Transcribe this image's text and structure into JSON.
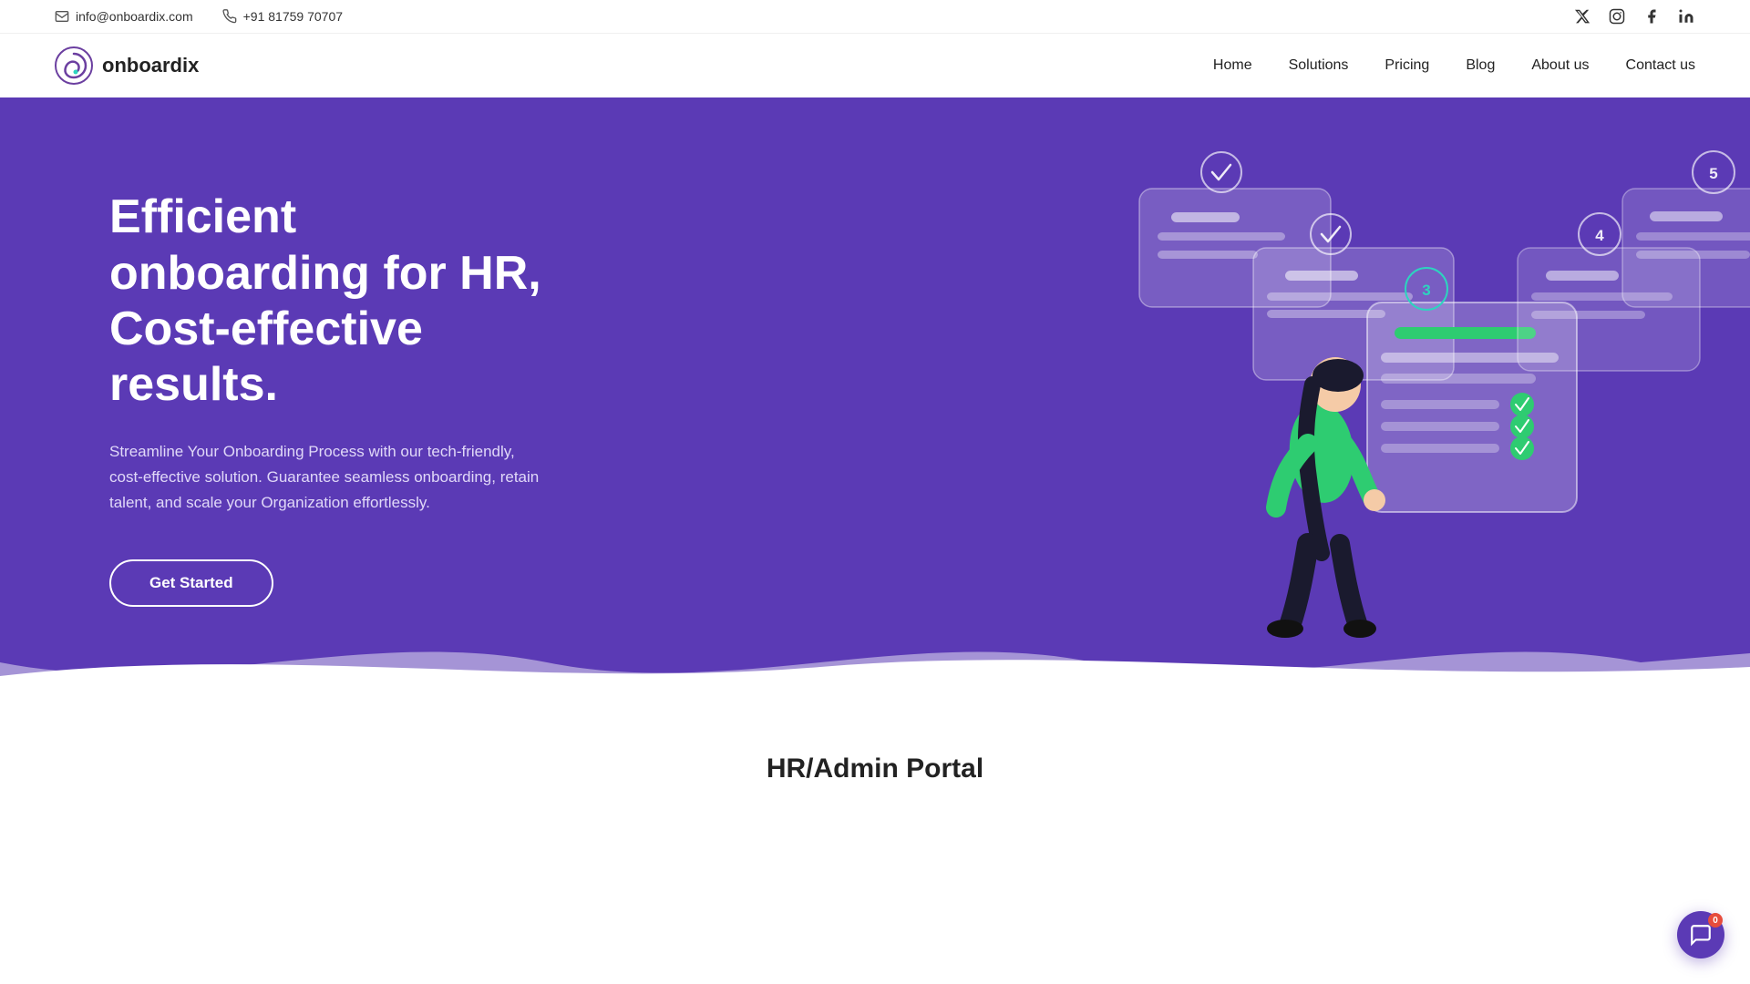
{
  "topbar": {
    "email": "info@onboardix.com",
    "phone": "+91 81759 70707",
    "email_icon": "✉",
    "phone_icon": "📞"
  },
  "social": {
    "twitter": "𝕏",
    "instagram": "📷",
    "facebook": "f",
    "linkedin": "in"
  },
  "logo": {
    "text": "onboardix"
  },
  "nav": {
    "home": "Home",
    "solutions": "Solutions",
    "pricing": "Pricing",
    "blog": "Blog",
    "about": "About us",
    "contact": "Contact us"
  },
  "hero": {
    "title": "Efficient onboarding for HR, Cost-effective results.",
    "subtitle": "Streamline Your Onboarding Process with our tech-friendly, cost-effective solution. Guarantee seamless onboarding, retain talent, and scale your Organization effortlessly.",
    "cta": "Get Started",
    "bg_color": "#5b3ab5"
  },
  "steps": {
    "s1": "✓",
    "s2": "✓",
    "s3": "3",
    "s4": "4",
    "s5": "5"
  },
  "bottom": {
    "section_title": "HR/Admin Portal"
  },
  "chat": {
    "badge": "0"
  }
}
